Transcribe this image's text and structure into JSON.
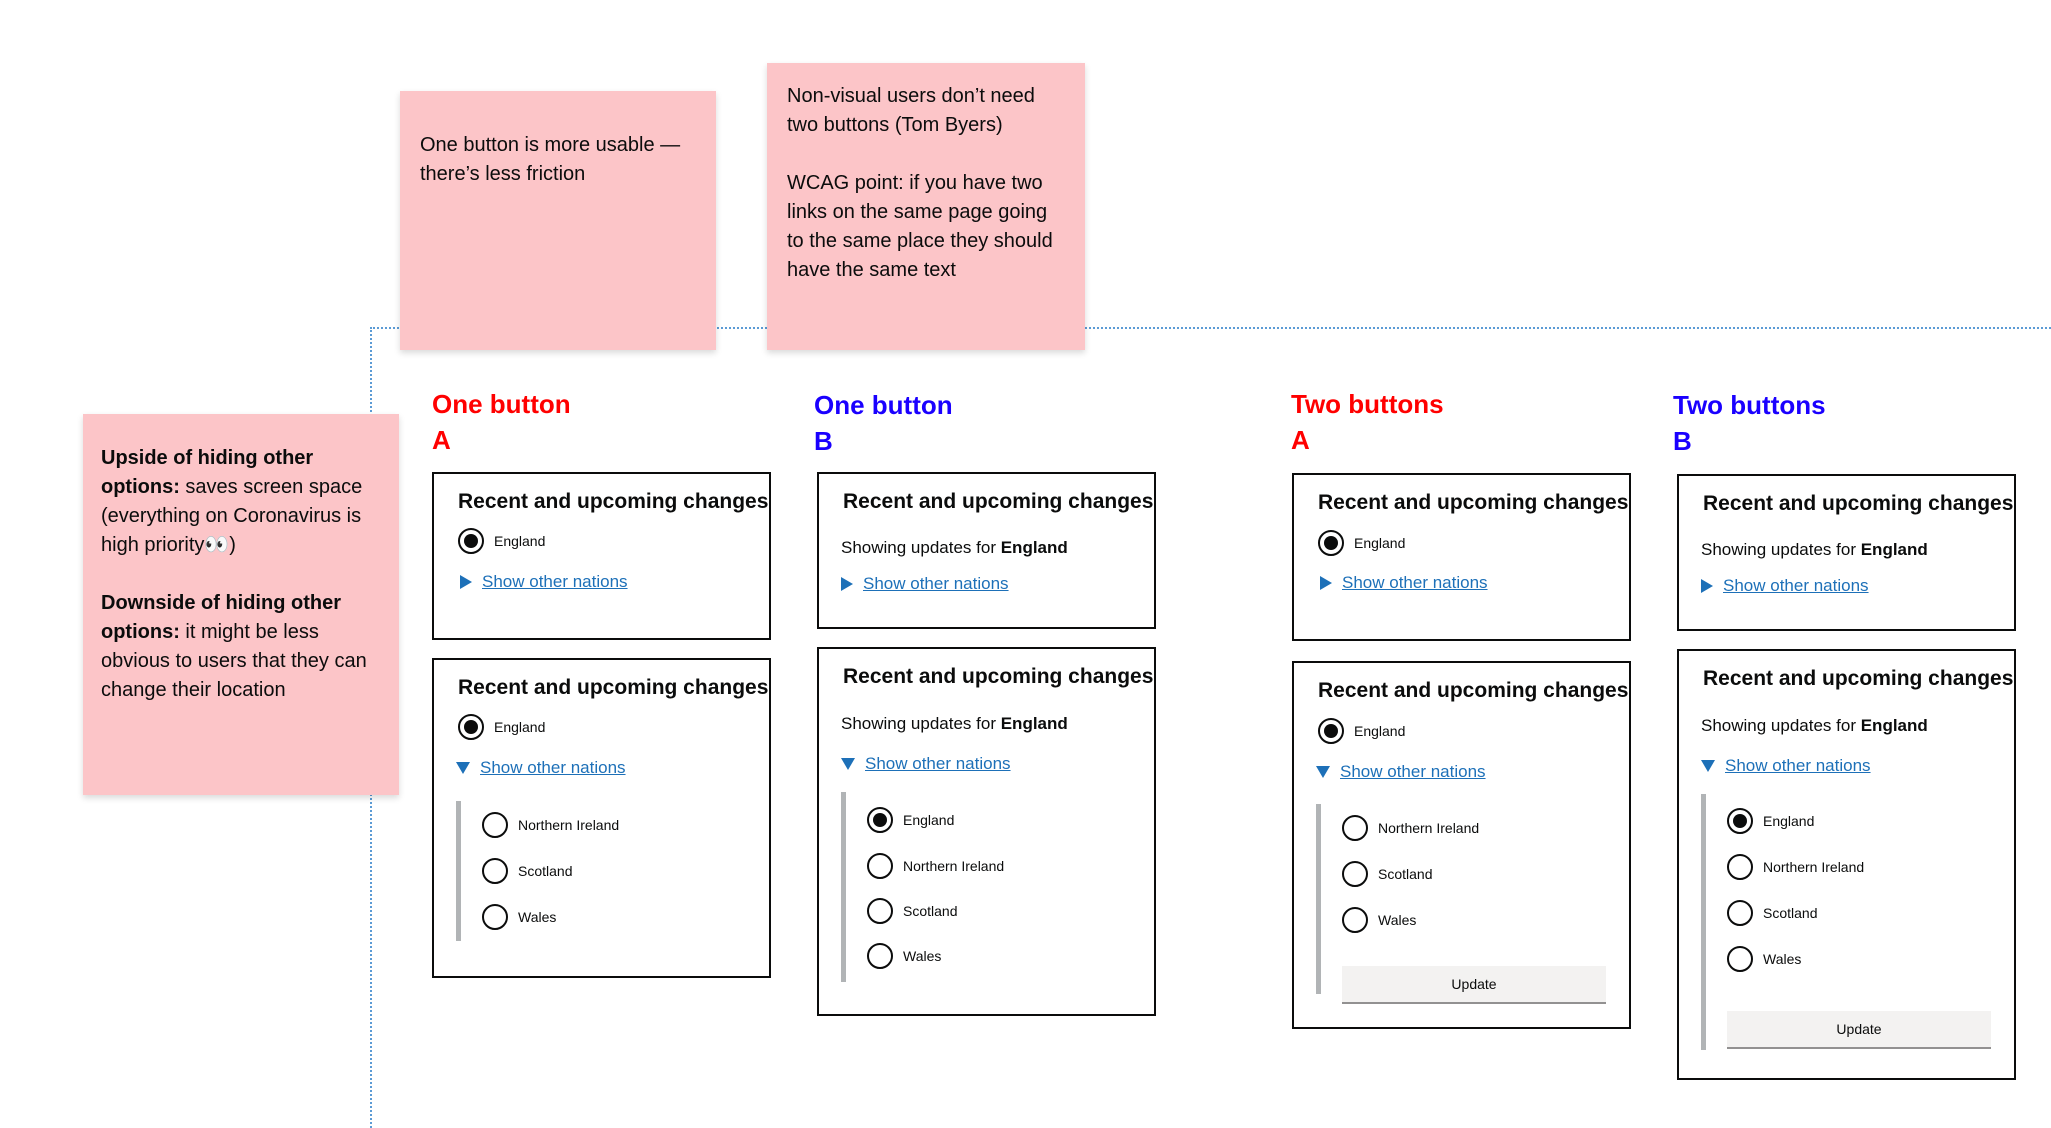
{
  "notes": {
    "left": {
      "upside_bold": "Upside of hiding other options:",
      "upside_text": " saves screen space (everything on Coronavirus is high priority👀)",
      "downside_bold": "Downside of hiding other options:",
      "downside_text": " it might be less obvious to users that they can change their location"
    },
    "middle": "One button is more usable — there’s less friction",
    "right": {
      "p1": "Non-visual users don’t need two buttons (Tom Byers)",
      "p2": "WCAG point: if you have two links on the same page going to the same place they should have the same text"
    }
  },
  "columns": [
    {
      "title": "One button",
      "variant": "A",
      "color": "#ff0000"
    },
    {
      "title": "One button",
      "variant": "B",
      "color": "#1a00ff"
    },
    {
      "title": "Two buttons",
      "variant": "A",
      "color": "#ff0000"
    },
    {
      "title": "Two buttons",
      "variant": "B",
      "color": "#1a00ff"
    }
  ],
  "component": {
    "heading": "Recent and upcoming changes",
    "showing_prefix": "Showing updates for ",
    "showing_location": "England",
    "toggle_label": "Show other nations",
    "update_label": "Update"
  },
  "nations": [
    "England",
    "Northern Ireland",
    "Scotland",
    "Wales"
  ]
}
